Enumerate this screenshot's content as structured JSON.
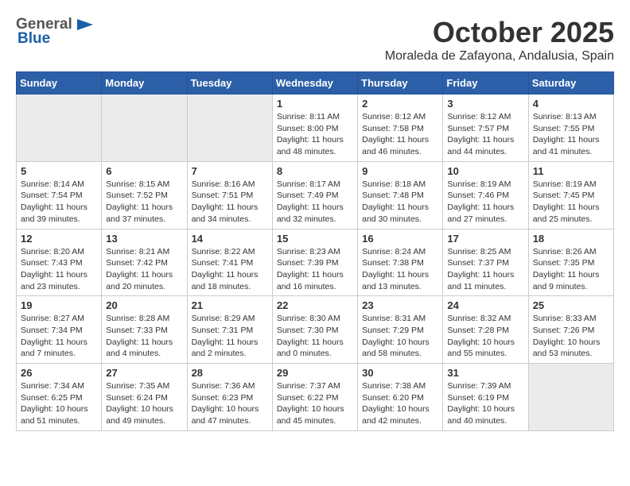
{
  "logo": {
    "general": "General",
    "blue": "Blue"
  },
  "title": "October 2025",
  "subtitle": "Moraleda de Zafayona, Andalusia, Spain",
  "weekdays": [
    "Sunday",
    "Monday",
    "Tuesday",
    "Wednesday",
    "Thursday",
    "Friday",
    "Saturday"
  ],
  "weeks": [
    [
      {
        "day": "",
        "info": ""
      },
      {
        "day": "",
        "info": ""
      },
      {
        "day": "",
        "info": ""
      },
      {
        "day": "1",
        "info": "Sunrise: 8:11 AM\nSunset: 8:00 PM\nDaylight: 11 hours and 48 minutes."
      },
      {
        "day": "2",
        "info": "Sunrise: 8:12 AM\nSunset: 7:58 PM\nDaylight: 11 hours and 46 minutes."
      },
      {
        "day": "3",
        "info": "Sunrise: 8:12 AM\nSunset: 7:57 PM\nDaylight: 11 hours and 44 minutes."
      },
      {
        "day": "4",
        "info": "Sunrise: 8:13 AM\nSunset: 7:55 PM\nDaylight: 11 hours and 41 minutes."
      }
    ],
    [
      {
        "day": "5",
        "info": "Sunrise: 8:14 AM\nSunset: 7:54 PM\nDaylight: 11 hours and 39 minutes."
      },
      {
        "day": "6",
        "info": "Sunrise: 8:15 AM\nSunset: 7:52 PM\nDaylight: 11 hours and 37 minutes."
      },
      {
        "day": "7",
        "info": "Sunrise: 8:16 AM\nSunset: 7:51 PM\nDaylight: 11 hours and 34 minutes."
      },
      {
        "day": "8",
        "info": "Sunrise: 8:17 AM\nSunset: 7:49 PM\nDaylight: 11 hours and 32 minutes."
      },
      {
        "day": "9",
        "info": "Sunrise: 8:18 AM\nSunset: 7:48 PM\nDaylight: 11 hours and 30 minutes."
      },
      {
        "day": "10",
        "info": "Sunrise: 8:19 AM\nSunset: 7:46 PM\nDaylight: 11 hours and 27 minutes."
      },
      {
        "day": "11",
        "info": "Sunrise: 8:19 AM\nSunset: 7:45 PM\nDaylight: 11 hours and 25 minutes."
      }
    ],
    [
      {
        "day": "12",
        "info": "Sunrise: 8:20 AM\nSunset: 7:43 PM\nDaylight: 11 hours and 23 minutes."
      },
      {
        "day": "13",
        "info": "Sunrise: 8:21 AM\nSunset: 7:42 PM\nDaylight: 11 hours and 20 minutes."
      },
      {
        "day": "14",
        "info": "Sunrise: 8:22 AM\nSunset: 7:41 PM\nDaylight: 11 hours and 18 minutes."
      },
      {
        "day": "15",
        "info": "Sunrise: 8:23 AM\nSunset: 7:39 PM\nDaylight: 11 hours and 16 minutes."
      },
      {
        "day": "16",
        "info": "Sunrise: 8:24 AM\nSunset: 7:38 PM\nDaylight: 11 hours and 13 minutes."
      },
      {
        "day": "17",
        "info": "Sunrise: 8:25 AM\nSunset: 7:37 PM\nDaylight: 11 hours and 11 minutes."
      },
      {
        "day": "18",
        "info": "Sunrise: 8:26 AM\nSunset: 7:35 PM\nDaylight: 11 hours and 9 minutes."
      }
    ],
    [
      {
        "day": "19",
        "info": "Sunrise: 8:27 AM\nSunset: 7:34 PM\nDaylight: 11 hours and 7 minutes."
      },
      {
        "day": "20",
        "info": "Sunrise: 8:28 AM\nSunset: 7:33 PM\nDaylight: 11 hours and 4 minutes."
      },
      {
        "day": "21",
        "info": "Sunrise: 8:29 AM\nSunset: 7:31 PM\nDaylight: 11 hours and 2 minutes."
      },
      {
        "day": "22",
        "info": "Sunrise: 8:30 AM\nSunset: 7:30 PM\nDaylight: 11 hours and 0 minutes."
      },
      {
        "day": "23",
        "info": "Sunrise: 8:31 AM\nSunset: 7:29 PM\nDaylight: 10 hours and 58 minutes."
      },
      {
        "day": "24",
        "info": "Sunrise: 8:32 AM\nSunset: 7:28 PM\nDaylight: 10 hours and 55 minutes."
      },
      {
        "day": "25",
        "info": "Sunrise: 8:33 AM\nSunset: 7:26 PM\nDaylight: 10 hours and 53 minutes."
      }
    ],
    [
      {
        "day": "26",
        "info": "Sunrise: 7:34 AM\nSunset: 6:25 PM\nDaylight: 10 hours and 51 minutes."
      },
      {
        "day": "27",
        "info": "Sunrise: 7:35 AM\nSunset: 6:24 PM\nDaylight: 10 hours and 49 minutes."
      },
      {
        "day": "28",
        "info": "Sunrise: 7:36 AM\nSunset: 6:23 PM\nDaylight: 10 hours and 47 minutes."
      },
      {
        "day": "29",
        "info": "Sunrise: 7:37 AM\nSunset: 6:22 PM\nDaylight: 10 hours and 45 minutes."
      },
      {
        "day": "30",
        "info": "Sunrise: 7:38 AM\nSunset: 6:20 PM\nDaylight: 10 hours and 42 minutes."
      },
      {
        "day": "31",
        "info": "Sunrise: 7:39 AM\nSunset: 6:19 PM\nDaylight: 10 hours and 40 minutes."
      },
      {
        "day": "",
        "info": ""
      }
    ]
  ]
}
